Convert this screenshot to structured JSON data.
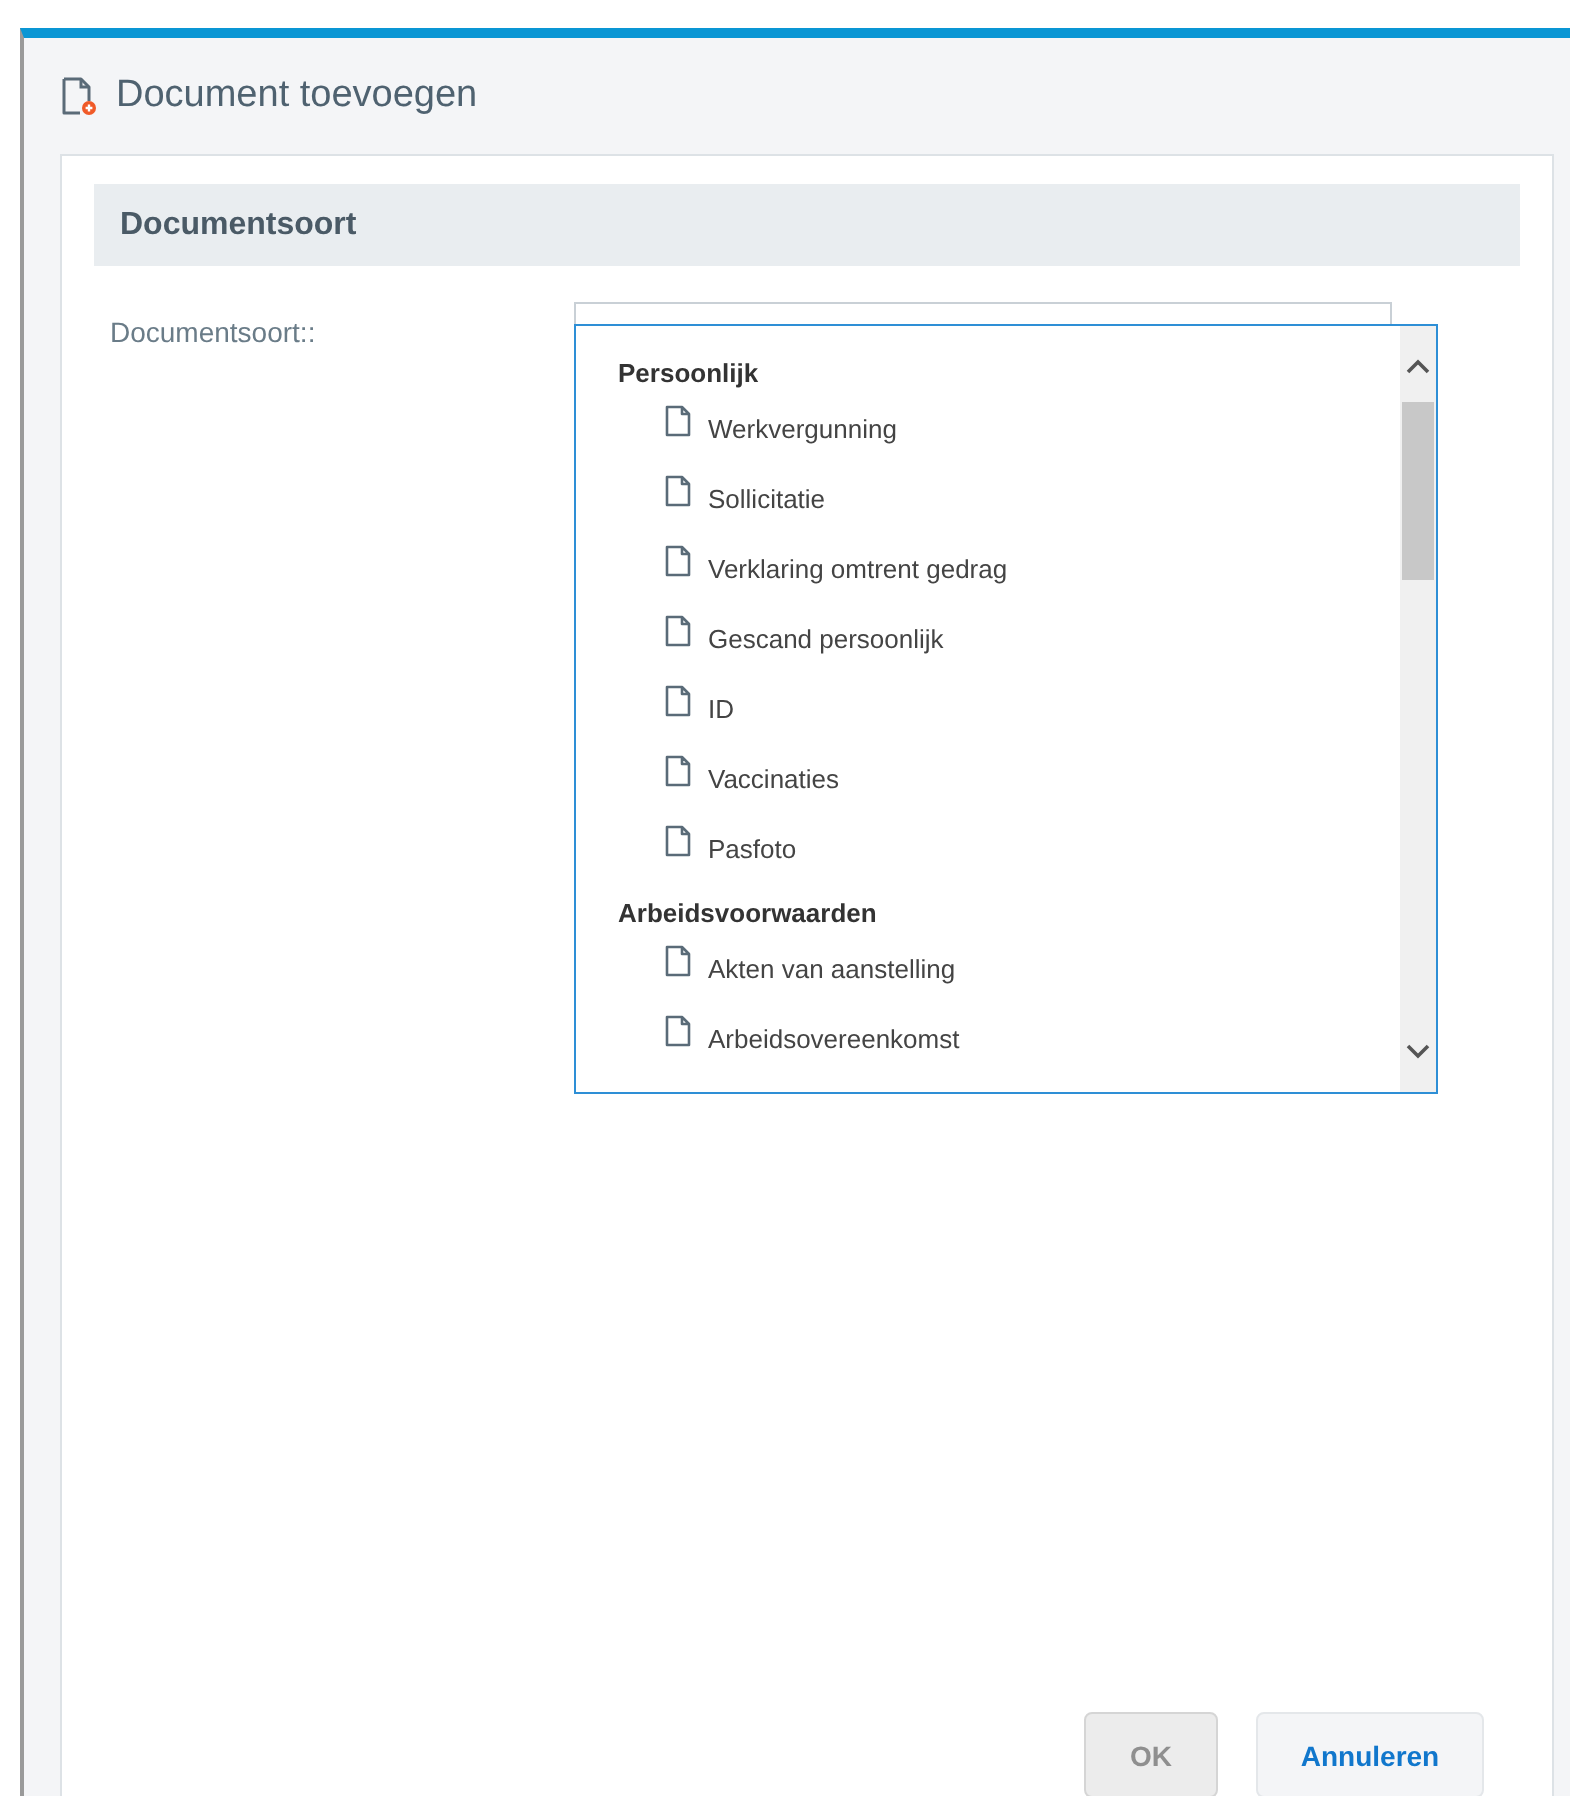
{
  "dialog": {
    "title": "Document toevoegen"
  },
  "section": {
    "title": "Documentsoort"
  },
  "field": {
    "label": "Documentsoort::",
    "expanded": true
  },
  "dropdown": {
    "groups": [
      {
        "label": "Persoonlijk",
        "items": [
          "Werkvergunning",
          "Sollicitatie",
          "Verklaring omtrent gedrag",
          "Gescand persoonlijk",
          "ID",
          "Vaccinaties",
          "Pasfoto"
        ]
      },
      {
        "label": "Arbeidsvoorwaarden",
        "items": [
          "Akten van aanstelling",
          "Arbeidsovereenkomst"
        ]
      }
    ]
  },
  "buttons": [
    {
      "label": "OK",
      "kind": "primary",
      "disabled": true
    },
    {
      "label": "Annuleren",
      "kind": "secondary",
      "disabled": false
    }
  ]
}
